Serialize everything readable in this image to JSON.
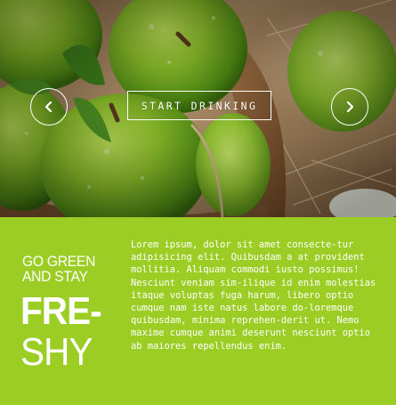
{
  "hero": {
    "cta_label": "START DRINKING",
    "prev_icon": "chevron-left-icon",
    "next_icon": "chevron-right-icon"
  },
  "panel": {
    "heading_line1": "GO GREEN",
    "heading_line2": "AND STAY",
    "big_line1": "FRE-",
    "big_line2": "SHY",
    "body": "Lorem ipsum, dolor sit amet consecte-tur adipisicing elit. Quibusdam a at provident mollitia. Aliquam commodi iusto possimus! Nesciunt veniam sim-ilique id enim molestias itaque voluptas fuga harum, libero optio cumque nam iste natus labore do-loremque quibusdam, minima reprehen-derit ut. Nemo maxime cumque animi deserunt nesciunt optio ab maiores repellendus enim."
  },
  "colors": {
    "panel_green": "#9bcd25",
    "text_white": "#ffffff"
  }
}
